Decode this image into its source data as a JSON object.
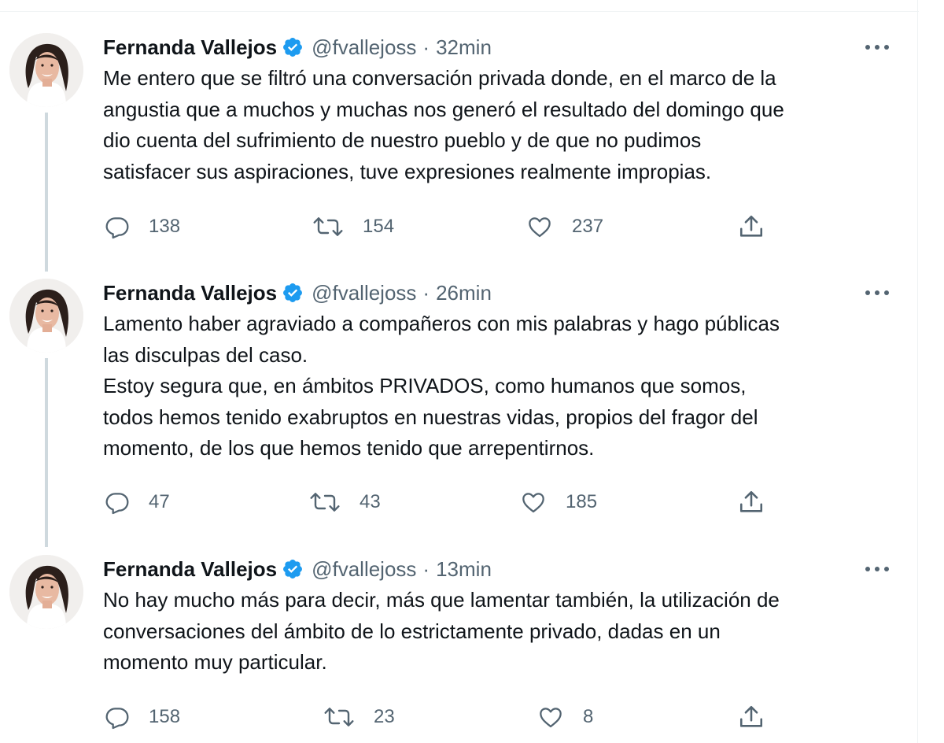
{
  "tweets": [
    {
      "name": "Fernanda Vallejos",
      "handle": "@fvallejoss",
      "time": "32min",
      "text": [
        "Me entero que se filtró una conversación privada donde, en el marco de la",
        "angustia que a muchos y muchas nos generó el resultado del domingo que",
        "dio cuenta del sufrimiento de nuestro pueblo y de que no pudimos",
        "satisfacer sus aspiraciones, tuve expresiones realmente impropias."
      ],
      "replies": "138",
      "retweets": "154",
      "likes": "237"
    },
    {
      "name": "Fernanda Vallejos",
      "handle": "@fvallejoss",
      "time": "26min",
      "text": [
        "Lamento haber agraviado a compañeros con mis palabras y hago públicas",
        "las disculpas del caso.",
        "Estoy segura que, en ámbitos PRIVADOS, como humanos que somos,",
        "todos hemos tenido exabruptos en nuestras vidas, propios del fragor del",
        "momento, de los que hemos tenido que arrepentirnos."
      ],
      "replies": "47",
      "retweets": "43",
      "likes": "185"
    },
    {
      "name": "Fernanda Vallejos",
      "handle": "@fvallejoss",
      "time": "13min",
      "text": [
        "No hay mucho más para decir, más que lamentar también, la utilización de",
        "conversaciones del ámbito de lo estrictamente privado, dadas en un",
        "momento muy particular."
      ],
      "replies": "158",
      "retweets": "23",
      "likes": "8"
    }
  ],
  "separator": "·",
  "icons": [
    "verified-badge-icon",
    "more-icon",
    "reply-icon",
    "retweet-icon",
    "like-icon",
    "share-icon"
  ],
  "colors": {
    "verified": "#1d9bf0",
    "secondary_text": "#536471",
    "thread_line": "#cfd9de"
  }
}
